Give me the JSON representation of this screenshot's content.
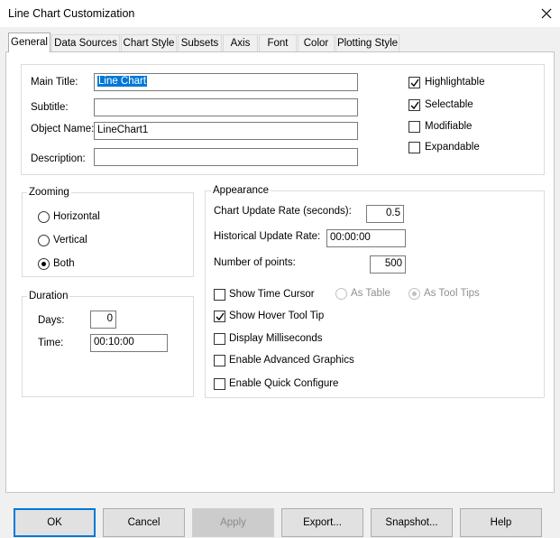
{
  "window": {
    "title": "Line Chart Customization"
  },
  "tabs": [
    "General",
    "Data Sources",
    "Chart Style",
    "Subsets",
    "Axis",
    "Font",
    "Color",
    "Plotting Style"
  ],
  "general": {
    "main_title_label": "Main Title:",
    "main_title_value": "Line Chart",
    "subtitle_label": "Subtitle:",
    "subtitle_value": "",
    "object_name_label": "Object Name:",
    "object_name_value": "LineChart1",
    "description_label": "Description:",
    "description_value": "",
    "options": {
      "highlightable": {
        "label": "Highlightable",
        "checked": true
      },
      "selectable": {
        "label": "Selectable",
        "checked": true
      },
      "modifiable": {
        "label": "Modifiable",
        "checked": false
      },
      "expandable": {
        "label": "Expandable",
        "checked": false
      }
    }
  },
  "zooming": {
    "legend": "Zooming",
    "horizontal": "Horizontal",
    "vertical": "Vertical",
    "both": "Both",
    "selected": "Both"
  },
  "duration": {
    "legend": "Duration",
    "days_label": "Days:",
    "days_value": "0",
    "time_label": "Time:",
    "time_value": "00:10:00"
  },
  "appearance": {
    "legend": "Appearance",
    "chart_update_rate_label": "Chart Update Rate (seconds):",
    "chart_update_rate_value": "0.5",
    "historical_update_rate_label": "Historical Update Rate:",
    "historical_update_rate_value": "00:00:00",
    "number_of_points_label": "Number of points:",
    "number_of_points_value": "500",
    "show_time_cursor": {
      "label": "Show Time Cursor",
      "checked": false
    },
    "as_table": "As Table",
    "as_tool_tips": "As Tool Tips",
    "show_hover_tool_tip": {
      "label": "Show Hover Tool Tip",
      "checked": true
    },
    "display_milliseconds": {
      "label": "Display Milliseconds",
      "checked": false
    },
    "enable_advanced_graphics": {
      "label": "Enable Advanced Graphics",
      "checked": false
    },
    "enable_quick_configure": {
      "label": "Enable Quick Configure",
      "checked": false
    }
  },
  "buttons": {
    "ok": "OK",
    "cancel": "Cancel",
    "apply": "Apply",
    "export": "Export...",
    "snapshot": "Snapshot...",
    "help": "Help"
  },
  "colors": {
    "selection": "#0078d7",
    "default_button_border": "#0078d7"
  },
  "icons": {
    "close": "close-icon",
    "checkmark": "checkmark-icon"
  }
}
